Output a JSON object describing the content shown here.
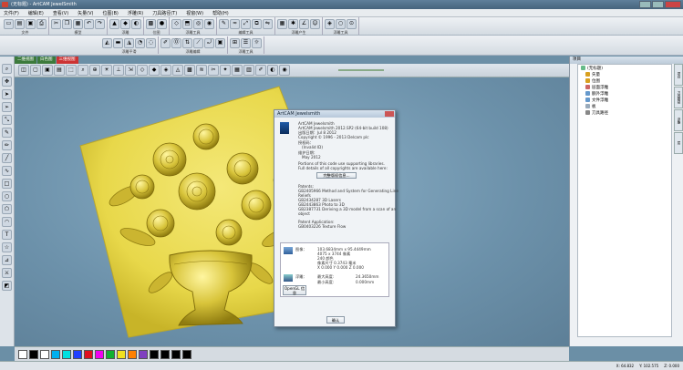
{
  "window": {
    "title": "(无标题) - ArtCAM JewelSmith"
  },
  "menu": [
    "文件(F)",
    "编辑(E)",
    "查看(V)",
    "矢量(V)",
    "位图(B)",
    "浮雕(R)",
    "刀具路径(T)",
    "视窗(W)",
    "帮助(H)"
  ],
  "toolbars": {
    "row1_groups": [
      "文件",
      "模型",
      "浮雕",
      "位图",
      "浮雕工具",
      "编辑工具",
      "浮雕产生",
      "浮雕工具"
    ],
    "row2_groups": [
      "浮雕平滑",
      "浮雕编辑",
      "浮雕工具"
    ]
  },
  "view_tabs": [
    "二维视图",
    "白色图",
    "三维视图"
  ],
  "active_view_tab": 2,
  "dialog": {
    "title": "ArtCAM Jewelsmith",
    "product": "ArtCAM Jewelsmith",
    "version_line": "ArtCAM Jewelsmith 2012.SP2 (64-bit build 108)",
    "build_date": "出版日期：Jul  8 2012",
    "copyright": "Copyright © 1996 - 2013 Delcam plc",
    "license_label": "授权码：",
    "license_value": "(Invalid ID)",
    "maint_label": "维护日期：",
    "maint_value": "May 2012",
    "notice1": "Portions of this code use supporting libraries.",
    "notice2": "Full details of all copyrights are available here:",
    "copyright_button": "完整版权信息...",
    "patents_label": "Patents:",
    "patents": [
      "GB2405966 Method and System for Generating Line",
      "Reliefs",
      "GB2434287 3D Lasers",
      "GB2443863 Photo to 3D",
      "GB2387731 Deriving a 3D model from a scan of an",
      "object"
    ],
    "pending_label": "Patent Application:",
    "pending": "GB0403226 Texture Flow",
    "image_label": "图像：",
    "image_lines": [
      "103.6834mm x 95.4449mm",
      "4075 x 3744 像素",
      "240 颜色",
      "像素尺寸 0.3743 毫米",
      "X 0.000  Y 0.000  Z 0.000"
    ],
    "relief_label": "浮雕：",
    "relief_lines": [
      "最大高度:",
      "最小高度:"
    ],
    "relief_values": [
      "24.3650mm",
      "0.000mm"
    ],
    "opengl_button": "OpenGL 信息",
    "ok_button": "确认"
  },
  "right_panel": {
    "header": "项目",
    "tree": [
      "(无标题)",
      "矢量",
      "位图",
      "层面浮雕",
      "额外浮雕",
      "文件浮雕",
      "板",
      "刀具路径"
    ],
    "side_tabs": [
      "项目",
      "刀具路径",
      "浮雕",
      "层"
    ]
  },
  "palette": [
    "#ffffff",
    "#000000",
    "#ffffff",
    "#00b0f0",
    "#00e0e0",
    "#2040ff",
    "#e01020",
    "#f000f0",
    "#10b030",
    "#f0e020",
    "#ff8000",
    "#8040c0",
    "#000000",
    "#000000",
    "#000000",
    "#000000"
  ],
  "status": {
    "x": "X: 64.832",
    "y": "Y: 102.575",
    "z": "Z: 0.000"
  },
  "colors": {
    "relief": "#e8d84a",
    "viewport": "#6c91aa",
    "accent_tab": "#c33333"
  }
}
